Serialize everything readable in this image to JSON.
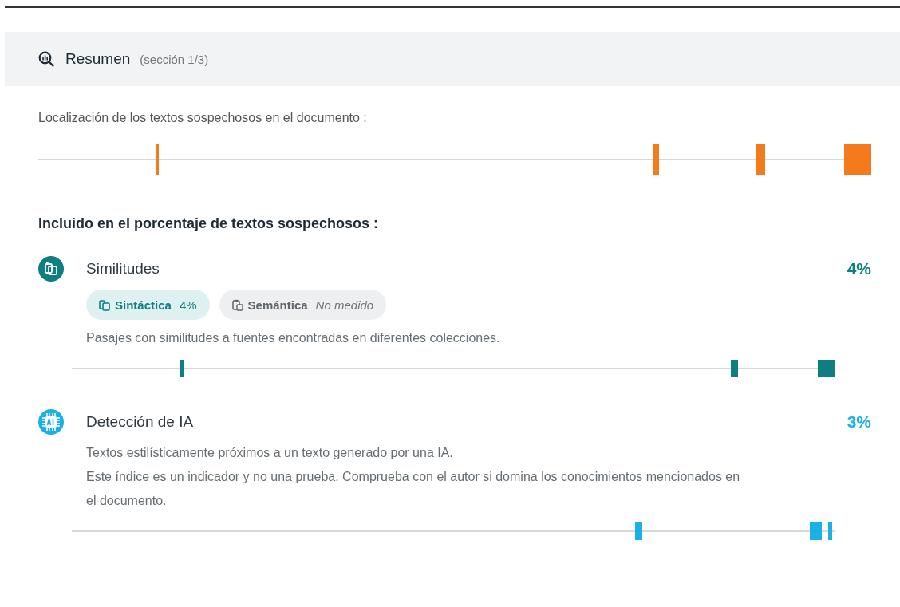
{
  "header": {
    "title": "Resumen",
    "subtitle": "(sección 1/3)"
  },
  "location": {
    "label": "Localización de los textos sospechosos en el documento :"
  },
  "included_heading": "Incluido en el porcentaje de textos sospechosos :",
  "sections": [
    {
      "kind": "similarity",
      "title": "Similitudes",
      "percent": "4%",
      "color": "#0e7f80",
      "chips": [
        {
          "label": "Sintáctica",
          "value": "4%",
          "measured": true
        },
        {
          "label": "Semántica",
          "value": "No medido",
          "measured": false
        }
      ],
      "description": [
        "Pasajes con similitudes a fuentes encontradas en diferentes colecciones."
      ]
    },
    {
      "kind": "ai",
      "title": "Detección de IA",
      "percent": "3%",
      "color": "#1ab0e8",
      "description": [
        "Textos estilísticamente próximos a un texto generado por una IA.",
        "Este índice es un indicador y no una prueba. Comprueba con el autor si domina los conocimientos mencionados en el documento."
      ]
    }
  ]
}
